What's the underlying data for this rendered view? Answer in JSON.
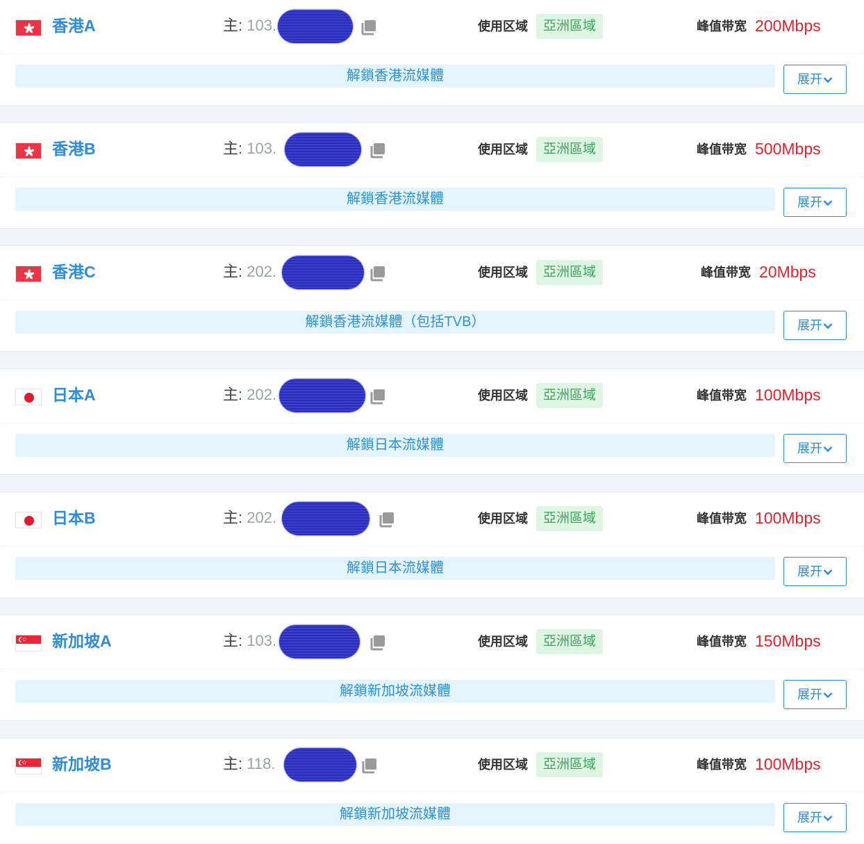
{
  "servers": [
    {
      "flag": "hk",
      "name": "香港A",
      "ip_label": "主:",
      "ip_prefix": "103.",
      "zone_label": "使用区域",
      "zone": "亞洲區域",
      "bw_label": "峰值带宽",
      "bw": "200Mbps",
      "unlock": "解鎖香港流媒體",
      "expand": "展开"
    },
    {
      "flag": "hk",
      "name": "香港B",
      "ip_label": "主:",
      "ip_prefix": "103.",
      "zone_label": "使用区域",
      "zone": "亞洲區域",
      "bw_label": "峰值带宽",
      "bw": "500Mbps",
      "unlock": "解鎖香港流媒體",
      "expand": "展开"
    },
    {
      "flag": "hk",
      "name": "香港C",
      "ip_label": "主:",
      "ip_prefix": "202.",
      "zone_label": "使用区域",
      "zone": "亞洲區域",
      "bw_label": "峰值带宽",
      "bw": "20Mbps",
      "unlock": "解鎖香港流媒體（包括TVB）",
      "expand": "展开"
    },
    {
      "flag": "jp",
      "name": "日本A",
      "ip_label": "主:",
      "ip_prefix": "202.",
      "zone_label": "使用区域",
      "zone": "亞洲區域",
      "bw_label": "峰值带宽",
      "bw": "100Mbps",
      "unlock": "解鎖日本流媒體",
      "expand": "展开"
    },
    {
      "flag": "jp",
      "name": "日本B",
      "ip_label": "主:",
      "ip_prefix": "202.",
      "zone_label": "使用区域",
      "zone": "亞洲區域",
      "bw_label": "峰值带宽",
      "bw": "100Mbps",
      "unlock": "解鎖日本流媒體",
      "expand": "展开"
    },
    {
      "flag": "sg",
      "name": "新加坡A",
      "ip_label": "主:",
      "ip_prefix": "103.",
      "zone_label": "使用区域",
      "zone": "亞洲區域",
      "bw_label": "峰值带宽",
      "bw": "150Mbps",
      "unlock": "解鎖新加坡流媒體",
      "expand": "展开"
    },
    {
      "flag": "sg",
      "name": "新加坡B",
      "ip_label": "主:",
      "ip_prefix": "118.",
      "zone_label": "使用区域",
      "zone": "亞洲區域",
      "bw_label": "峰值带宽",
      "bw": "100Mbps",
      "unlock": "解鎖新加坡流媒體",
      "expand": "展开"
    }
  ],
  "colors": {
    "name": "#2d8ddb",
    "bandwidth": "#e8212b",
    "zone_bg": "#dff5e3",
    "zone_text": "#3aa55a",
    "unlock_bg": "#e3f4fe",
    "accent": "#2a8be0"
  },
  "icons": {
    "copy": "copy-icon",
    "expand": "chevron-down-icon",
    "flags": [
      "hong-kong-flag-icon",
      "japan-flag-icon",
      "singapore-flag-icon"
    ]
  }
}
